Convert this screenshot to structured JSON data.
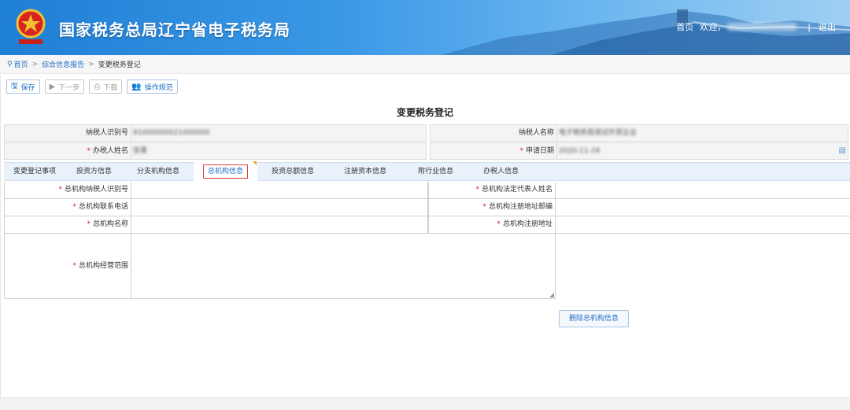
{
  "header": {
    "title": "国家税务总局辽宁省电子税务局",
    "home": "首页",
    "welcome": "欢迎，",
    "separator": "|",
    "logout": "退出",
    "emblem_text": "辽宁税务"
  },
  "breadcrumb": {
    "home": "首页",
    "parent": "综合信息报告",
    "current": "变更税务登记",
    "sep": ">"
  },
  "toolbar": {
    "save": "保存",
    "next": "下一步",
    "download": "下载",
    "guide": "操作规范"
  },
  "form": {
    "title": "变更税务登记",
    "taxpayer_id_label": "纳税人识别号",
    "taxpayer_id_value": "91000000021000000",
    "taxpayer_name_label": "纳税人名称",
    "taxpayer_name_value": "电子税务局测试外贸企业",
    "handler_label": "办税人姓名",
    "handler_value": "张某",
    "apply_date_label": "申请日期",
    "apply_date_value": "2020-11-16"
  },
  "tabs": [
    {
      "label": "变更登记事项"
    },
    {
      "label": "投资方信息"
    },
    {
      "label": "分支机构信息"
    },
    {
      "label": "总机构信息"
    },
    {
      "label": "投资总额信息"
    },
    {
      "label": "注册资本信息"
    },
    {
      "label": "附行业信息"
    },
    {
      "label": "办税人信息"
    }
  ],
  "hq": {
    "id_label": "总机构纳税人识别号",
    "legal_rep_label": "总机构法定代表人姓名",
    "phone_label": "总机构联系电话",
    "postcode_label": "总机构注册地址邮编",
    "name_label": "总机构名称",
    "address_label": "总机构注册地址",
    "scope_label": "总机构经营范围",
    "delete_button": "删除总机构信息"
  },
  "colors": {
    "accent": "#1f6fc5",
    "required": "#e02020",
    "active_tab_border": "#e23a3a"
  }
}
